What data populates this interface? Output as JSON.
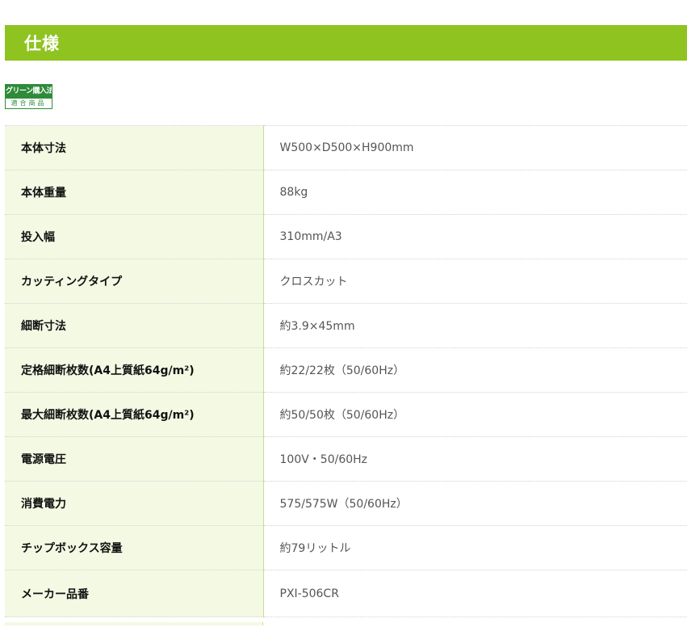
{
  "header": {
    "title": "仕様"
  },
  "badge": {
    "top_text": "グリーン購入法",
    "bottom_text": "適合商品"
  },
  "colors": {
    "header_bg": "#8fc31f",
    "label_bg": "#f4f9e4",
    "badge_green": "#2e8b3a"
  },
  "specs": [
    {
      "label": "本体寸法",
      "value": "W500×D500×H900mm"
    },
    {
      "label": "本体重量",
      "value": "88kg"
    },
    {
      "label": "投入幅",
      "value": "310mm/A3"
    },
    {
      "label": "カッティングタイプ",
      "value": "クロスカット"
    },
    {
      "label": "細断寸法",
      "value": "約3.9×45mm"
    },
    {
      "label": "定格細断枚数(A4上質紙64g/m²)",
      "value": "約22/22枚（50/60Hz）"
    },
    {
      "label": "最大細断枚数(A4上質紙64g/m²)",
      "value": "約50/50枚（50/60Hz）"
    },
    {
      "label": "電源電圧",
      "value": "100V・50/60Hz"
    },
    {
      "label": "消費電力",
      "value": "575/575W（50/60Hz）"
    },
    {
      "label": "チップボックス容量",
      "value": "約79リットル"
    },
    {
      "label": "メーカー品番",
      "value": "PXI-506CR"
    }
  ]
}
